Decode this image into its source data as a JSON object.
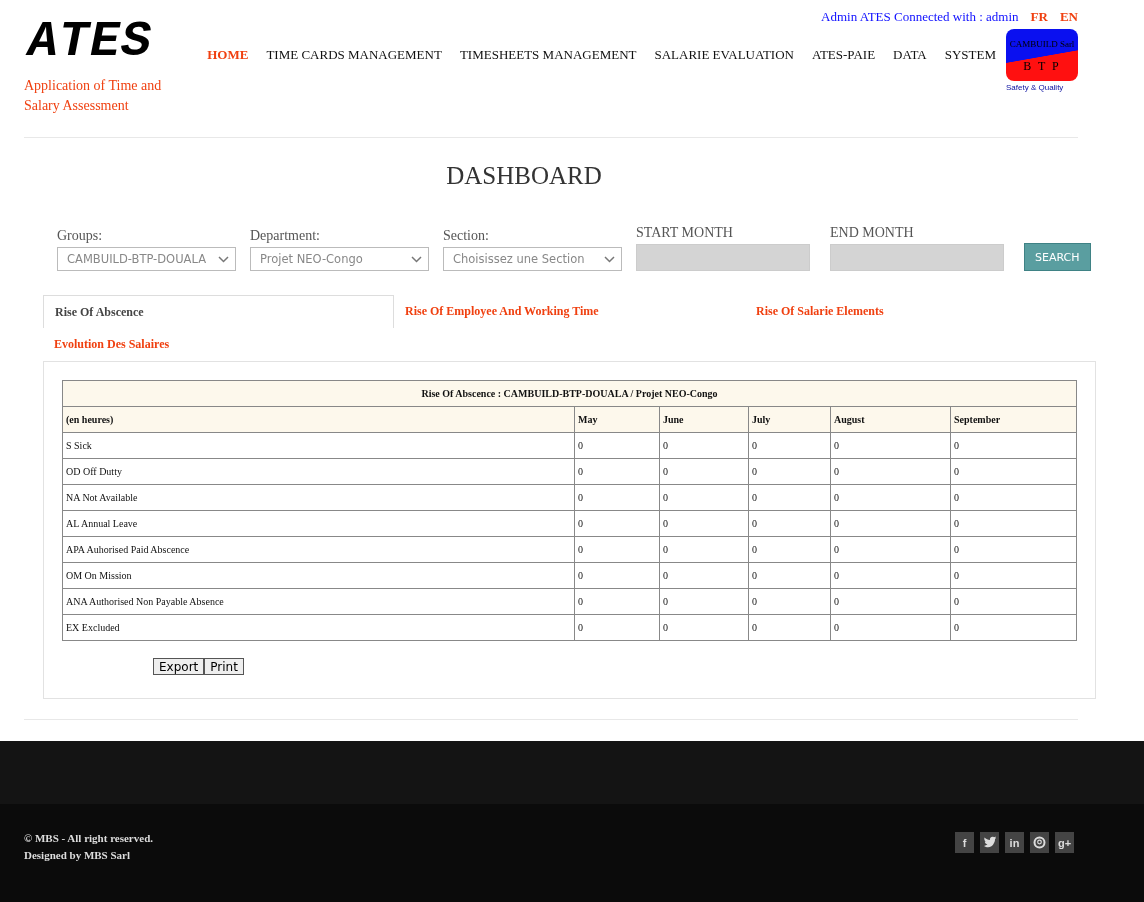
{
  "brand": {
    "logo": "ATES",
    "tagline": "Application of Time and Salary Assessment"
  },
  "user_bar": {
    "text": "Admin ATES Connected with : admin",
    "languages": [
      "FR",
      "EN"
    ]
  },
  "nav": [
    {
      "label": "HOME",
      "selected": true
    },
    {
      "label": "TIME CARDS MANAGEMENT",
      "selected": false
    },
    {
      "label": "TIMESHEETS MANAGEMENT",
      "selected": false
    },
    {
      "label": "SALARIE EVALUATION",
      "selected": false
    },
    {
      "label": "ATES-PAIE",
      "selected": false
    },
    {
      "label": "DATA",
      "selected": false
    },
    {
      "label": "SYSTEM",
      "selected": false
    }
  ],
  "company_logo": {
    "name": "CAMBUILD Sarl",
    "sub": "B T P",
    "motto": "Safety & Quality"
  },
  "title": "DASHBOARD",
  "filters": [
    {
      "kind": "select",
      "label": "Groups:",
      "value": "CAMBUILD-BTP-DOUALA"
    },
    {
      "kind": "select",
      "label": "Department:",
      "value": "Projet NEO-Congo"
    },
    {
      "kind": "select",
      "label": "Section:",
      "value": "Choisissez une Section"
    },
    {
      "kind": "input",
      "label": "START MONTH"
    },
    {
      "kind": "input",
      "label": "END MONTH"
    }
  ],
  "search_button": "SEARCH",
  "tabs": [
    {
      "label": "Rise Of Abscence",
      "selected": true
    },
    {
      "label": "Rise Of Employee And Working Time",
      "selected": false
    },
    {
      "label": "Rise Of Salarie Elements",
      "selected": false
    },
    {
      "label": "Evolution Des Salaires",
      "selected": false
    }
  ],
  "table": {
    "caption": "Rise Of Abscence : CAMBUILD-BTP-DOUALA / Projet NEO-Congo",
    "columns": [
      "(en heures)",
      "May",
      "June",
      "July",
      "August",
      "September"
    ],
    "rows": [
      [
        "S Sick",
        "0",
        "0",
        "0",
        "0",
        "0"
      ],
      [
        "OD Off Dutty",
        "0",
        "0",
        "0",
        "0",
        "0"
      ],
      [
        "NA Not Available",
        "0",
        "0",
        "0",
        "0",
        "0"
      ],
      [
        "AL Annual Leave",
        "0",
        "0",
        "0",
        "0",
        "0"
      ],
      [
        "APA Auhorised Paid Abscence",
        "0",
        "0",
        "0",
        "0",
        "0"
      ],
      [
        "OM On Mission",
        "0",
        "0",
        "0",
        "0",
        "0"
      ],
      [
        "ANA Authorised Non Payable Absence",
        "0",
        "0",
        "0",
        "0",
        "0"
      ],
      [
        "EX Excluded",
        "0",
        "0",
        "0",
        "0",
        "0"
      ]
    ]
  },
  "actions": [
    "Export",
    "Print"
  ],
  "footer": {
    "copyright": "© MBS - All right reserved.",
    "designed_by": "Designed by MBS Sarl",
    "social": [
      {
        "kind": "facebook",
        "glyph": "f"
      },
      {
        "kind": "twitter"
      },
      {
        "kind": "linkedin",
        "glyph": "in"
      },
      {
        "kind": "pinterest"
      },
      {
        "kind": "googleplus",
        "glyph": "g+"
      }
    ]
  }
}
